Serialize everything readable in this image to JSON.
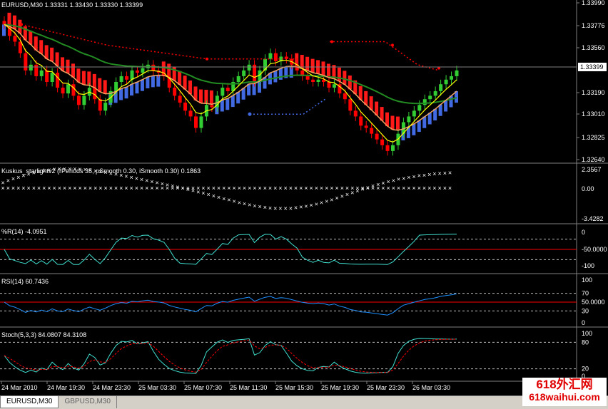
{
  "window": {
    "main_header": "EURUSD,M30  1.33331 1.33430 1.33330 1.33399",
    "current_price": "1.33399"
  },
  "price_axis": [
    "1.33990",
    "1.33776",
    "1.33560",
    "1.33190",
    "1.33010",
    "1.32825",
    "1.32640"
  ],
  "time_axis": [
    "24 Mar 2010",
    "24 Mar 19:30",
    "24 Mar 23:30",
    "25 Mar 03:30",
    "25 Mar 07:30",
    "25 Mar 11:30",
    "25 Mar 15:30",
    "25 Mar 19:30",
    "25 Mar 23:30",
    "26 Mar 03:30"
  ],
  "indicators": {
    "kuskus": {
      "header": "Kuskus_starlightv2 (rPeriods 35, pSmooth 0.30, iSmooth 0.30)  0.1863",
      "levels": [
        "2.3567",
        "0.00",
        "-3.4282"
      ]
    },
    "wpr": {
      "header": "%R(14) -4.0951",
      "levels": [
        "0",
        "-50.0000",
        "-100"
      ]
    },
    "rsi": {
      "header": "RSI(14) 60.7436",
      "levels": [
        "100",
        "70",
        "50.0000",
        "30",
        "0"
      ]
    },
    "stoch": {
      "header": "Stoch(5,3,3) 84.0807 84.3108",
      "levels": [
        "100",
        "80",
        "20",
        "0"
      ]
    }
  },
  "tabs": [
    {
      "label": "EURUSD,M30",
      "active": true
    },
    {
      "label": "GBPUSD,M30",
      "active": false
    }
  ],
  "watermark": {
    "line1": "618外汇网",
    "line2": "618waihui.com"
  },
  "colors": {
    "bull": "#32cd32",
    "bear": "#ff0000",
    "band_red": "#ff1a1a",
    "band_blue": "#4169e1",
    "ma_slow": "#228b22",
    "ma_fast": "#ffff00",
    "ma_mid": "#f4a460",
    "osc_line": "#40e0d0",
    "rsi_line": "#1e90ff",
    "level_red": "#ff0000"
  },
  "chart_data": {
    "type": "line",
    "closes": [
      1.338,
      1.337,
      1.3365,
      1.3355,
      1.334,
      1.3345,
      1.3335,
      1.334,
      1.333,
      1.3338,
      1.3325,
      1.332,
      1.3328,
      1.3318,
      1.331,
      1.3318,
      1.3325,
      1.3315,
      1.3305,
      1.3312,
      1.3322,
      1.333,
      1.3335,
      1.3332,
      1.334,
      1.3338,
      1.3342,
      1.3345,
      1.334,
      1.3338,
      1.3335,
      1.3325,
      1.3318,
      1.3312,
      1.3305,
      1.33,
      1.329,
      1.33,
      1.331,
      1.3308,
      1.3318,
      1.3325,
      1.3322,
      1.333,
      1.3335,
      1.334,
      1.3345,
      1.333,
      1.334,
      1.335,
      1.3355,
      1.3348,
      1.3352,
      1.335,
      1.3345,
      1.334,
      1.3335,
      1.3332,
      1.333,
      1.3332,
      1.333,
      1.3325,
      1.3328,
      1.332,
      1.3315,
      1.3305,
      1.33,
      1.3292,
      1.329,
      1.3285,
      1.328,
      1.3275,
      1.327,
      1.3275,
      1.3285,
      1.3295,
      1.33,
      1.3305,
      1.331,
      1.3315,
      1.3318,
      1.3322,
      1.3328,
      1.3332,
      1.3335,
      1.334
    ],
    "series": [
      {
        "values_sample": "fast/mid/slow MA derived from closes"
      }
    ]
  }
}
